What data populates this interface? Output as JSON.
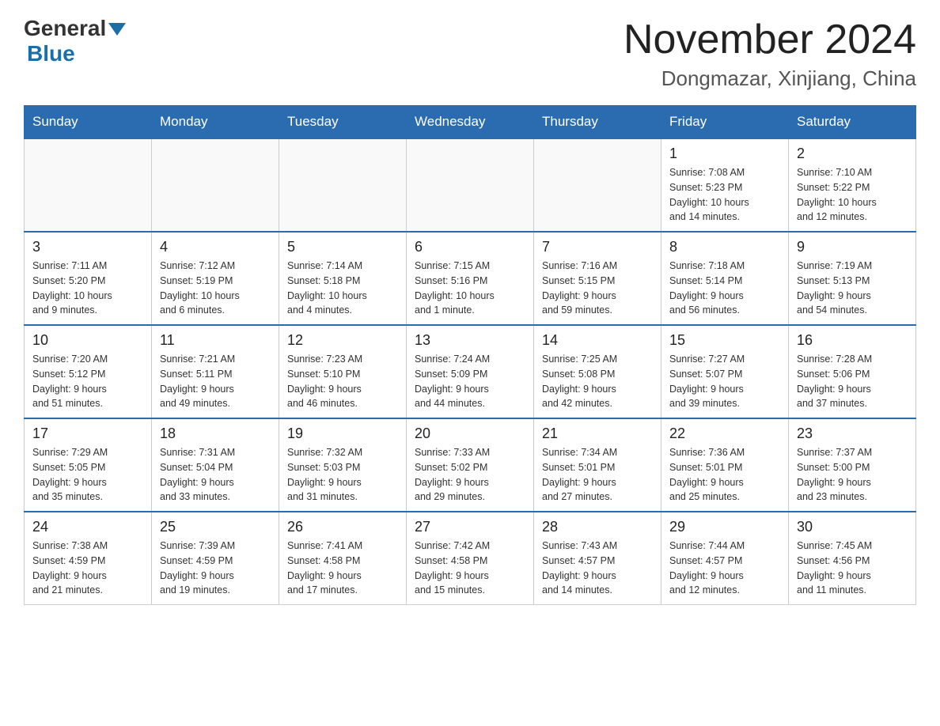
{
  "header": {
    "logo_general": "General",
    "logo_blue": "Blue",
    "month_title": "November 2024",
    "location": "Dongmazar, Xinjiang, China"
  },
  "weekdays": [
    "Sunday",
    "Monday",
    "Tuesday",
    "Wednesday",
    "Thursday",
    "Friday",
    "Saturday"
  ],
  "weeks": [
    [
      {
        "day": "",
        "info": ""
      },
      {
        "day": "",
        "info": ""
      },
      {
        "day": "",
        "info": ""
      },
      {
        "day": "",
        "info": ""
      },
      {
        "day": "",
        "info": ""
      },
      {
        "day": "1",
        "info": "Sunrise: 7:08 AM\nSunset: 5:23 PM\nDaylight: 10 hours\nand 14 minutes."
      },
      {
        "day": "2",
        "info": "Sunrise: 7:10 AM\nSunset: 5:22 PM\nDaylight: 10 hours\nand 12 minutes."
      }
    ],
    [
      {
        "day": "3",
        "info": "Sunrise: 7:11 AM\nSunset: 5:20 PM\nDaylight: 10 hours\nand 9 minutes."
      },
      {
        "day": "4",
        "info": "Sunrise: 7:12 AM\nSunset: 5:19 PM\nDaylight: 10 hours\nand 6 minutes."
      },
      {
        "day": "5",
        "info": "Sunrise: 7:14 AM\nSunset: 5:18 PM\nDaylight: 10 hours\nand 4 minutes."
      },
      {
        "day": "6",
        "info": "Sunrise: 7:15 AM\nSunset: 5:16 PM\nDaylight: 10 hours\nand 1 minute."
      },
      {
        "day": "7",
        "info": "Sunrise: 7:16 AM\nSunset: 5:15 PM\nDaylight: 9 hours\nand 59 minutes."
      },
      {
        "day": "8",
        "info": "Sunrise: 7:18 AM\nSunset: 5:14 PM\nDaylight: 9 hours\nand 56 minutes."
      },
      {
        "day": "9",
        "info": "Sunrise: 7:19 AM\nSunset: 5:13 PM\nDaylight: 9 hours\nand 54 minutes."
      }
    ],
    [
      {
        "day": "10",
        "info": "Sunrise: 7:20 AM\nSunset: 5:12 PM\nDaylight: 9 hours\nand 51 minutes."
      },
      {
        "day": "11",
        "info": "Sunrise: 7:21 AM\nSunset: 5:11 PM\nDaylight: 9 hours\nand 49 minutes."
      },
      {
        "day": "12",
        "info": "Sunrise: 7:23 AM\nSunset: 5:10 PM\nDaylight: 9 hours\nand 46 minutes."
      },
      {
        "day": "13",
        "info": "Sunrise: 7:24 AM\nSunset: 5:09 PM\nDaylight: 9 hours\nand 44 minutes."
      },
      {
        "day": "14",
        "info": "Sunrise: 7:25 AM\nSunset: 5:08 PM\nDaylight: 9 hours\nand 42 minutes."
      },
      {
        "day": "15",
        "info": "Sunrise: 7:27 AM\nSunset: 5:07 PM\nDaylight: 9 hours\nand 39 minutes."
      },
      {
        "day": "16",
        "info": "Sunrise: 7:28 AM\nSunset: 5:06 PM\nDaylight: 9 hours\nand 37 minutes."
      }
    ],
    [
      {
        "day": "17",
        "info": "Sunrise: 7:29 AM\nSunset: 5:05 PM\nDaylight: 9 hours\nand 35 minutes."
      },
      {
        "day": "18",
        "info": "Sunrise: 7:31 AM\nSunset: 5:04 PM\nDaylight: 9 hours\nand 33 minutes."
      },
      {
        "day": "19",
        "info": "Sunrise: 7:32 AM\nSunset: 5:03 PM\nDaylight: 9 hours\nand 31 minutes."
      },
      {
        "day": "20",
        "info": "Sunrise: 7:33 AM\nSunset: 5:02 PM\nDaylight: 9 hours\nand 29 minutes."
      },
      {
        "day": "21",
        "info": "Sunrise: 7:34 AM\nSunset: 5:01 PM\nDaylight: 9 hours\nand 27 minutes."
      },
      {
        "day": "22",
        "info": "Sunrise: 7:36 AM\nSunset: 5:01 PM\nDaylight: 9 hours\nand 25 minutes."
      },
      {
        "day": "23",
        "info": "Sunrise: 7:37 AM\nSunset: 5:00 PM\nDaylight: 9 hours\nand 23 minutes."
      }
    ],
    [
      {
        "day": "24",
        "info": "Sunrise: 7:38 AM\nSunset: 4:59 PM\nDaylight: 9 hours\nand 21 minutes."
      },
      {
        "day": "25",
        "info": "Sunrise: 7:39 AM\nSunset: 4:59 PM\nDaylight: 9 hours\nand 19 minutes."
      },
      {
        "day": "26",
        "info": "Sunrise: 7:41 AM\nSunset: 4:58 PM\nDaylight: 9 hours\nand 17 minutes."
      },
      {
        "day": "27",
        "info": "Sunrise: 7:42 AM\nSunset: 4:58 PM\nDaylight: 9 hours\nand 15 minutes."
      },
      {
        "day": "28",
        "info": "Sunrise: 7:43 AM\nSunset: 4:57 PM\nDaylight: 9 hours\nand 14 minutes."
      },
      {
        "day": "29",
        "info": "Sunrise: 7:44 AM\nSunset: 4:57 PM\nDaylight: 9 hours\nand 12 minutes."
      },
      {
        "day": "30",
        "info": "Sunrise: 7:45 AM\nSunset: 4:56 PM\nDaylight: 9 hours\nand 11 minutes."
      }
    ]
  ]
}
